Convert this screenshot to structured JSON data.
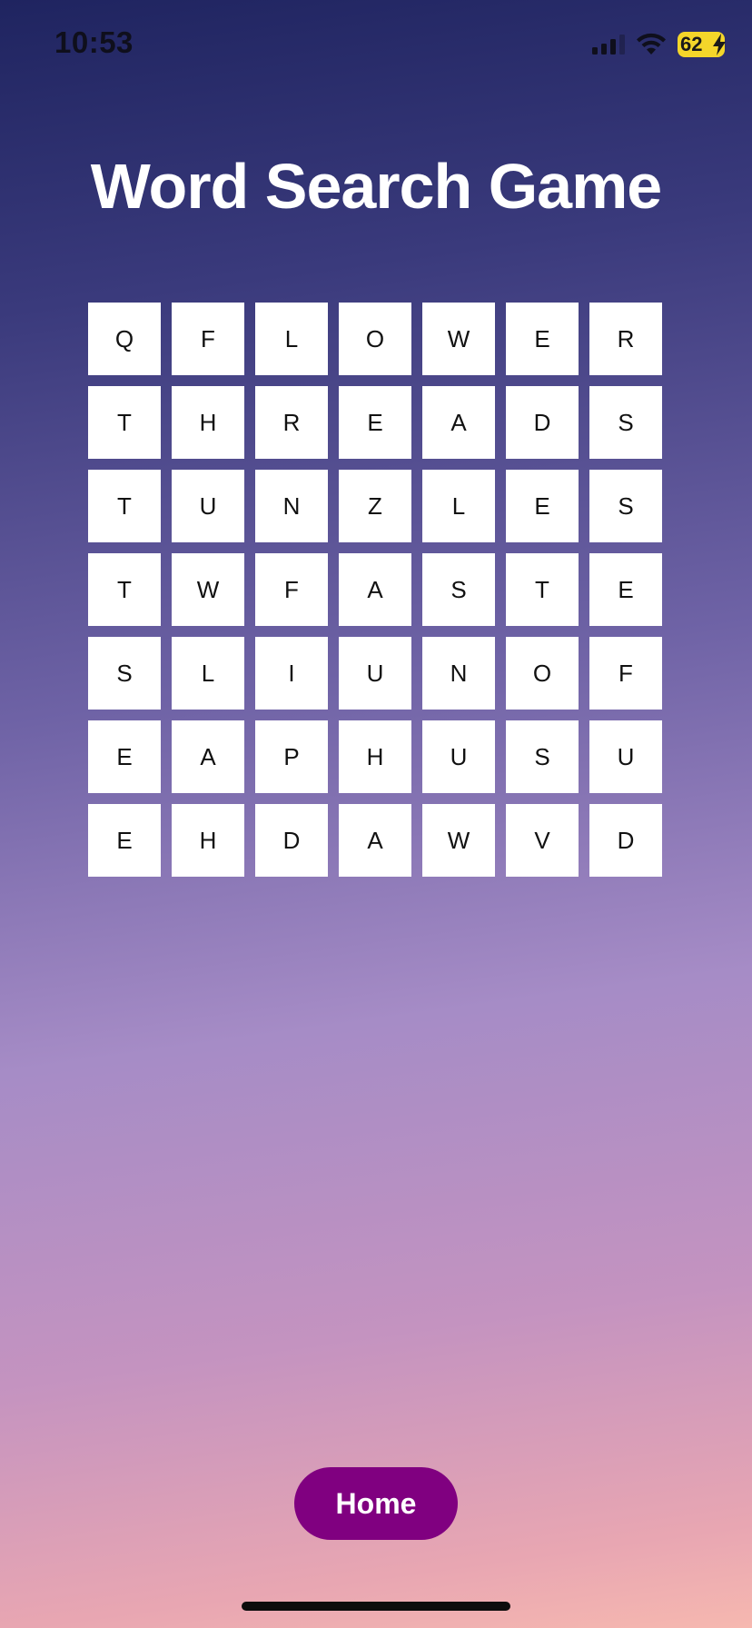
{
  "status_bar": {
    "time": "10:53",
    "battery_level": "62",
    "icons": [
      "signal-icon",
      "wifi-icon",
      "battery-icon",
      "bolt-icon"
    ]
  },
  "title": "Word Search Game",
  "grid": [
    [
      "Q",
      "F",
      "L",
      "O",
      "W",
      "E",
      "R"
    ],
    [
      "T",
      "H",
      "R",
      "E",
      "A",
      "D",
      "S"
    ],
    [
      "T",
      "U",
      "N",
      "Z",
      "L",
      "E",
      "S"
    ],
    [
      "T",
      "W",
      "F",
      "A",
      "S",
      "T",
      "E"
    ],
    [
      "S",
      "L",
      "I",
      "U",
      "N",
      "O",
      "F"
    ],
    [
      "E",
      "A",
      "P",
      "H",
      "U",
      "S",
      "U"
    ],
    [
      "E",
      "H",
      "D",
      "A",
      "W",
      "V",
      "D"
    ]
  ],
  "home_button": {
    "label": "Home"
  },
  "colors": {
    "button": "#800080",
    "battery": "#f4d62a",
    "cell_background": "#ffffff",
    "title": "#ffffff"
  }
}
